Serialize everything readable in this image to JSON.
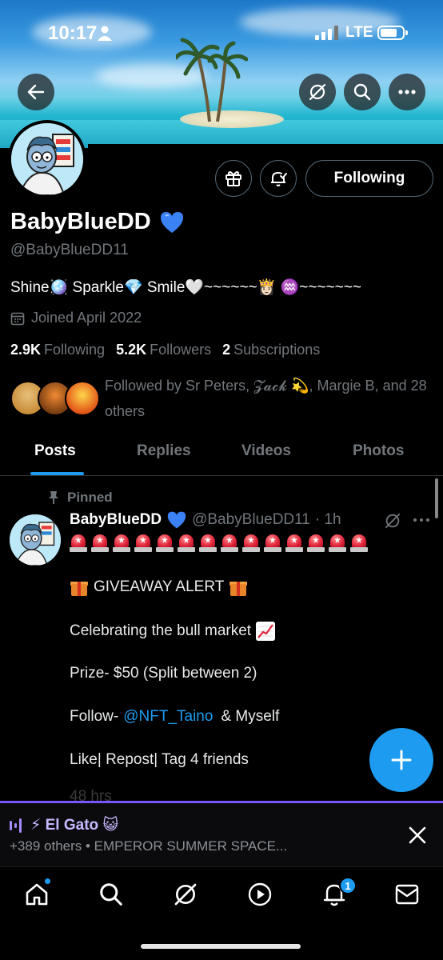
{
  "status_bar": {
    "time": "10:17",
    "network": "LTE"
  },
  "profile": {
    "display_name": "BabyBlueDD",
    "handle": "@BabyBlueDD11",
    "bio": "Shine🪩 Sparkle💎 Smile🤍~~~~~~👸🏻 ♒️~~~~~~~",
    "joined": "Joined April 2022",
    "following_count": "2.9K",
    "following_label": "Following",
    "followers_count": "5.2K",
    "followers_label": "Followers",
    "subscriptions_count": "2",
    "subscriptions_label": "Subscriptions",
    "follow_button_label": "Following",
    "followed_by": "Followed by Sr Peters, 𝓩𝓪𝓬𝓴 💫, Margie B, and 28 others",
    "verified_color": "#3b82f6"
  },
  "tabs": [
    {
      "label": "Posts",
      "active": true
    },
    {
      "label": "Replies",
      "active": false
    },
    {
      "label": "Videos",
      "active": false
    },
    {
      "label": "Photos",
      "active": false
    }
  ],
  "post": {
    "pinned_label": "Pinned",
    "author_name": "BabyBlueDD",
    "author_handle": "@BabyBlueDD11",
    "time": "· 1h",
    "siren_count": 14,
    "line_giveaway": "GIVEAWAY ALERT",
    "line_celebrate": "Celebrating the bull market",
    "line_prize": "Prize- $50 (Split between 2)",
    "line_follow_prefix": "Follow-",
    "line_follow_mention": "@NFT_Taino",
    "line_follow_suffix": "& Myself",
    "line_like": "Like| Repost| Tag 4 friends",
    "line_cut": "48 hrs"
  },
  "spaces": {
    "title": "⚡ El Gato 😺",
    "subtitle": "+389 others • EMPEROR SUMMER SPACE..."
  },
  "nav": {
    "notifications_badge": "1"
  },
  "colors": {
    "accent": "#1d9bf0",
    "spaces": "#7856ff",
    "muted": "#71767b"
  },
  "icons": [
    "back-arrow-icon",
    "grok-icon",
    "search-icon",
    "more-icon",
    "gift-icon",
    "bell-check-icon",
    "calendar-icon",
    "pin-icon",
    "plus-icon",
    "close-icon",
    "home-icon",
    "play-icon",
    "bell-icon",
    "mail-icon",
    "audio-wave-icon"
  ]
}
